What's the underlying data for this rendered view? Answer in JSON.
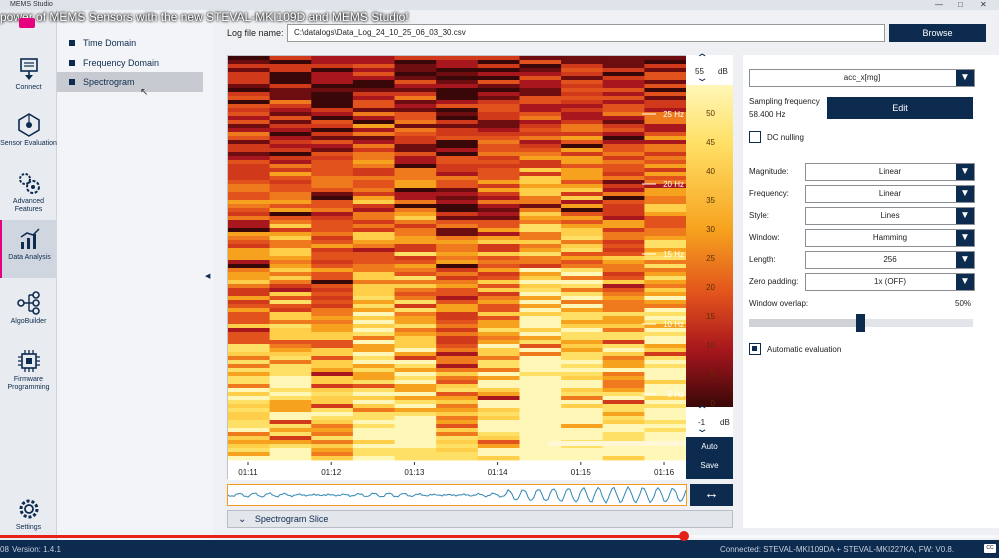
{
  "window": {
    "app_title": "MEMS Studio",
    "video_title": "power of MEMS Sensors with the new STEVAL-MKI109D and MEMS Studio!"
  },
  "nav": {
    "items": [
      {
        "label": "Connect",
        "icon": "connect-icon"
      },
      {
        "label": "Sensor Evaluation",
        "icon": "sensor-evaluation-icon"
      },
      {
        "label": "Advanced Features",
        "icon": "advanced-features-icon"
      },
      {
        "label": "Data Analysis",
        "icon": "data-analysis-icon",
        "active": true
      },
      {
        "label": "AlgoBuilder",
        "icon": "algobuilder-icon"
      },
      {
        "label": "Firmware Programming",
        "icon": "firmware-icon"
      },
      {
        "label": "Settings",
        "icon": "settings-icon"
      }
    ]
  },
  "subnav": {
    "items": [
      {
        "label": "Time Domain",
        "selected": false
      },
      {
        "label": "Frequency Domain",
        "selected": false
      },
      {
        "label": "Spectrogram",
        "selected": true
      }
    ]
  },
  "logfile": {
    "label": "Log file name:",
    "value": "C:\\datalogs\\Data_Log_24_10_25_06_03_30.csv",
    "browse_label": "Browse"
  },
  "chart_data": {
    "type": "heatmap",
    "x_ticks": [
      "01:11",
      "01:12",
      "01:13",
      "01:14",
      "01:15",
      "01:16"
    ],
    "freq_ticks": [
      "25 Hz",
      "20 Hz",
      "15 Hz",
      "10 Hz",
      "5 Hz"
    ],
    "colorbar": {
      "unit": "dB",
      "max": "55",
      "min": "-1",
      "ticks": [
        "50",
        "45",
        "40",
        "35",
        "30",
        "25",
        "20",
        "15",
        "10",
        "5",
        "0"
      ],
      "colors": [
        "#3a0708",
        "#a8171d",
        "#e2521c",
        "#f6a21e",
        "#ffe066",
        "#fff7b8"
      ]
    },
    "auto_label": "Auto",
    "save_label": "Save"
  },
  "slice": {
    "label": "Spectrogram Slice"
  },
  "panel": {
    "channel": "acc_x[mg]",
    "sampling_label": "Sampling frequency",
    "sampling_value": "58.400 Hz",
    "edit_label": "Edit",
    "dc_nulling_label": "DC nulling",
    "dc_nulling_checked": false,
    "fields": [
      {
        "label": "Magnitude:",
        "value": "Linear"
      },
      {
        "label": "Frequency:",
        "value": "Linear"
      },
      {
        "label": "Style:",
        "value": "Lines"
      },
      {
        "label": "Window:",
        "value": "Hamming"
      },
      {
        "label": "Length:",
        "value": "256"
      },
      {
        "label": "Zero padding:",
        "value": "1x (OFF)"
      }
    ],
    "overlap_label": "Window overlap:",
    "overlap_value": "50%",
    "overlap_fraction": 0.5,
    "auto_eval_label": "Automatic evaluation",
    "auto_eval_checked": true
  },
  "status": {
    "version": "Version: 1.4.1",
    "time_fragment": "08",
    "connected": "Connected:  STEVAL-MKI109DA + STEVAL-MKI227KA, FW: V0.8.",
    "cc": "CC",
    "progress": 0.685
  }
}
